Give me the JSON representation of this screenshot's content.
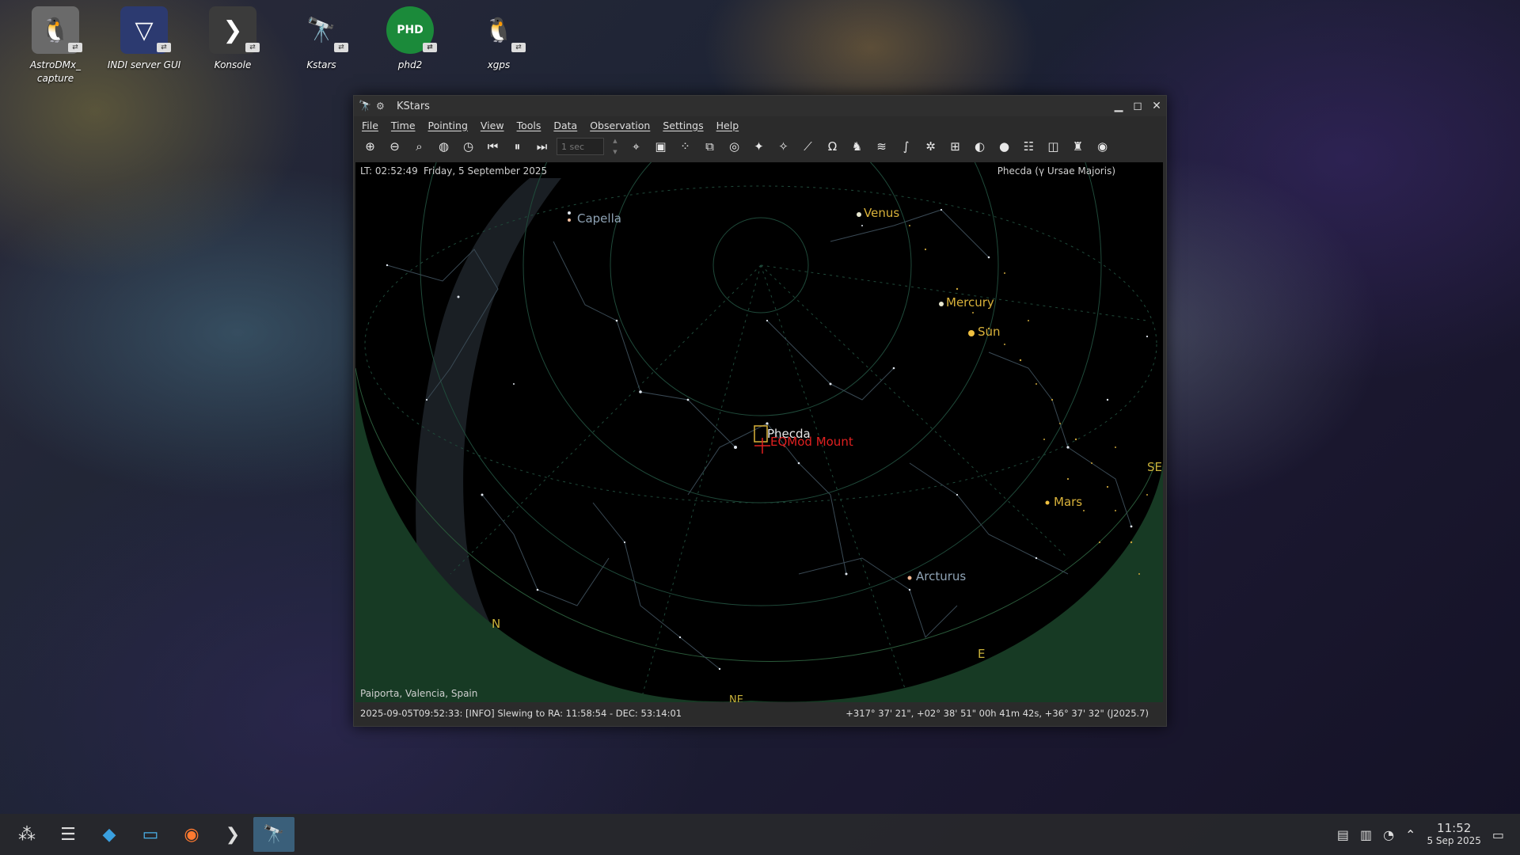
{
  "desktop": {
    "icons": [
      {
        "label": "AstroDMx_\ncapture",
        "icon": "astrodmx-icon"
      },
      {
        "label": "INDI server GUI",
        "icon": "indi-icon"
      },
      {
        "label": "Konsole",
        "icon": "terminal-icon"
      },
      {
        "label": "Kstars",
        "icon": "telescope-icon"
      },
      {
        "label": "phd2",
        "icon": "phd2-icon"
      },
      {
        "label": "xgps",
        "icon": "tux-icon"
      }
    ]
  },
  "window": {
    "title": "KStars",
    "menu": [
      "File",
      "Time",
      "Pointing",
      "View",
      "Tools",
      "Data",
      "Observation",
      "Settings",
      "Help"
    ],
    "time_step": "1 sec"
  },
  "sky": {
    "local_time": "LT: 02:52:49",
    "date": "Friday, 5 September 2025",
    "focus_object": "Phecda (γ Ursae Majoris)",
    "location": "Paiporta, Valencia, Spain",
    "labels": {
      "capella": "Capella",
      "venus": "Venus",
      "mercury": "Mercury",
      "sun": "Sun",
      "phecda": "Phecda",
      "mount": "EQMod Mount",
      "mars": "Mars",
      "arcturus": "Arcturus",
      "north": "N",
      "east": "E",
      "southeast": "SE",
      "northeast": "NE"
    }
  },
  "statusbar": {
    "message": "2025-09-05T09:52:33: [INFO] Slewing to RA: 11:58:54 - DEC: 53:14:01",
    "coords": "+317° 37' 21\", +02° 38' 51\"  00h 41m 42s, +36° 37' 32\" (J2025.7)"
  },
  "taskbar": {
    "clock_time": "11:52",
    "clock_date": "5 Sep 2025"
  },
  "colors": {
    "planet": "#d9b23a",
    "mount": "#e02020",
    "horizon": "#173a24",
    "grid": "#1f4a3a"
  }
}
